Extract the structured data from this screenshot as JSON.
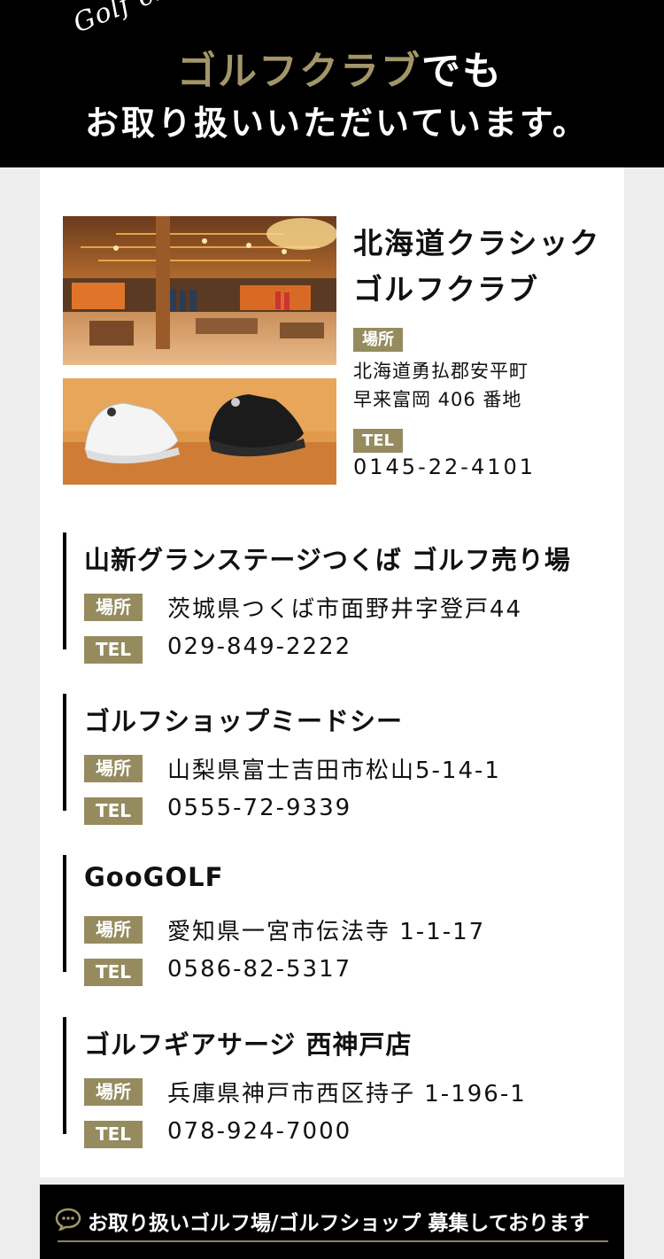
{
  "header": {
    "script_text": "Golf club",
    "title_gold": "ゴルフクラブ",
    "title_suffix": "でも",
    "subtitle": "お取り扱いいただいています。"
  },
  "featured": {
    "name_line1": "北海道クラシック",
    "name_line2": "ゴルフクラブ",
    "place_label": "場所",
    "address_line1": "北海道勇払郡安平町",
    "address_line2": "早来富岡 406 番地",
    "tel_label": "TEL",
    "tel": "0145-22-4101"
  },
  "stores": [
    {
      "name": "山新グランステージつくば ゴルフ売り場",
      "place_label": "場所",
      "address": "茨城県つくば市面野井字登戸44",
      "tel_label": "TEL",
      "tel": "029-849-2222"
    },
    {
      "name": "ゴルフショップミードシー",
      "place_label": "場所",
      "address": "山梨県富士吉田市松山5-14-1",
      "tel_label": "TEL",
      "tel": "0555-72-9339"
    },
    {
      "name": "GooGOLF",
      "place_label": "場所",
      "address": "愛知県一宮市伝法寺 1-1-17",
      "tel_label": "TEL",
      "tel": "0586-82-5317"
    },
    {
      "name": "ゴルフギアサージ 西神戸店",
      "place_label": "場所",
      "address": "兵庫県神戸市西区持子 1-196-1",
      "tel_label": "TEL",
      "tel": "078-924-7000"
    }
  ],
  "banner": {
    "text": "お取り扱いゴルフ場/ゴルフショップ 募集しております",
    "icon": "chat-bubble-icon"
  },
  "colors": {
    "gold": "#958b5f",
    "black": "#000000",
    "panel": "#ffffff",
    "bg": "#ededed"
  }
}
